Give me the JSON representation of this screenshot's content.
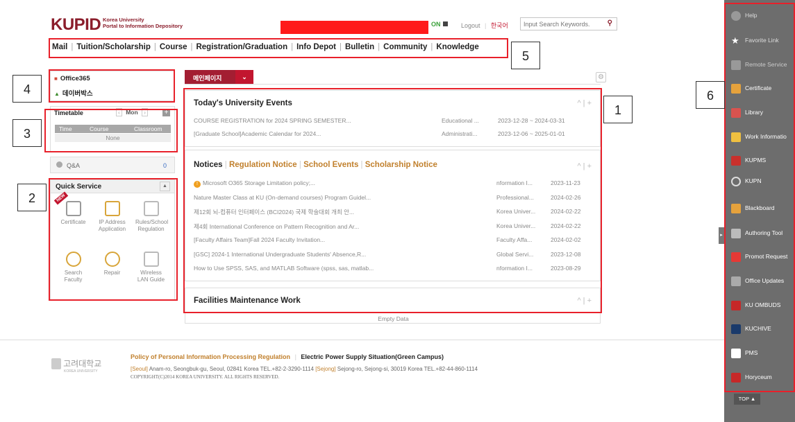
{
  "header": {
    "logo_word": "KUPID",
    "logo_sub_line1": "Korea University",
    "logo_sub_line2": "Portal to Information Depository",
    "status_on": "ON",
    "logout": "Logout",
    "language": "한국어",
    "search_placeholder": "Input Search Keywords."
  },
  "nav": [
    "Mail",
    "Tuition/Scholarship",
    "Course",
    "Registration/Graduation",
    "Info Depot",
    "Bulletin",
    "Community",
    "Knowledge"
  ],
  "annotations": [
    "1",
    "2",
    "3",
    "4",
    "5",
    "6"
  ],
  "links_box": {
    "office365": "Office365",
    "korean_item": "데이버박스"
  },
  "timetable": {
    "title": "Timetable",
    "day": "Mon",
    "columns": [
      "Time",
      "Course",
      "Classroom"
    ],
    "empty": "None"
  },
  "qa": {
    "label": "Q&A",
    "count": "0"
  },
  "quick_service": {
    "title": "Quick Service",
    "items": [
      {
        "label": "Certificate",
        "icon": "certificate-icon"
      },
      {
        "label": "IP Address Application",
        "icon": "monitor-icon"
      },
      {
        "label": "Rules/School Regulation",
        "icon": "document-icon"
      },
      {
        "label": "Search Faculty",
        "icon": "person-search-icon"
      },
      {
        "label": "Repair",
        "icon": "gear-icon"
      },
      {
        "label": "Wireless LAN Guide",
        "icon": "phone-icon"
      }
    ],
    "badge": "NEW"
  },
  "main": {
    "tab_label": "메인페이지",
    "events": {
      "title": "Today's University Events",
      "rows": [
        {
          "title": "COURSE REGISTRATION for 2024 SPRING SEMESTER...",
          "category": "Educational ...",
          "date": "2023-12-28 ~ 2024-03-31"
        },
        {
          "title": "[Graduate School]Academic Calendar for 2024...",
          "category": "Administrati...",
          "date": "2023-12-06 ~ 2025-01-01"
        }
      ]
    },
    "notices": {
      "tabs": [
        "Notices",
        "Regulation Notice",
        "School Events",
        "Scholarship Notice"
      ],
      "rows": [
        {
          "title": "Microsoft O365 Storage Limitation policy;...",
          "category": "nformation I...",
          "date": "2023-11-23"
        },
        {
          "title": "Nature Master Class at KU (On-demand courses) Program Guidel...",
          "category": "Professional...",
          "date": "2024-02-26"
        },
        {
          "title": "제12회 뇌-컴퓨터 인터페이스 (BCI2024) 국제 학술대회 개최 안...",
          "category": "Korea Univer...",
          "date": "2024-02-22"
        },
        {
          "title": "제4회 International Conference on Pattern Recognition and Ar...",
          "category": "Korea Univer...",
          "date": "2024-02-22"
        },
        {
          "title": "[Faculty Affairs Team]Fall 2024 Faculty Invitation...",
          "category": "Faculty Affa...",
          "date": "2024-02-02"
        },
        {
          "title": "[GSC] 2024-1 International Undergraduate Students' Absence,R...",
          "category": "Global Servi...",
          "date": "2023-12-08"
        },
        {
          "title": "How to Use SPSS, SAS, and MATLAB Software (spss, sas, matlab...",
          "category": "nformation I...",
          "date": "2023-08-29"
        }
      ]
    },
    "facilities": {
      "title": "Facilities Maintenance Work",
      "empty": "Empty Data"
    }
  },
  "footer": {
    "uni_name": "고려대학교",
    "uni_sub": "KOREA UNIVERSITY",
    "policy": "Policy of Personal Information Processing Regulation",
    "power": "Electric Power Supply Situation(Green Campus)",
    "address_seoul_tag": "[Seoul]",
    "address_seoul": "Anam-ro, Seongbuk-gu, Seoul, 02841 Korea TEL.+82-2-3290-1114",
    "address_sejong_tag": "[Sejong]",
    "address_sejong": "Sejong-ro, Sejong-si, 30019 Korea TEL.+82-44-860-1114",
    "copyright": "COPYRIGHT(C)2014 KOREA UNIVERSITY. ALL RIGHTS RESERVED."
  },
  "sidebar": {
    "items": [
      {
        "label": "Help",
        "icon": "help-icon"
      },
      {
        "label": "Favorite Link",
        "icon": "star-icon"
      },
      {
        "label": "Remote Service",
        "icon": "remote-icon"
      },
      {
        "label": "Certificate",
        "icon": "certificate-icon"
      },
      {
        "label": "Library",
        "icon": "library-icon"
      },
      {
        "label": "Work Informatio",
        "icon": "work-icon"
      },
      {
        "label": "KUPMS",
        "icon": "kupms-icon"
      },
      {
        "label": "KUPN",
        "icon": "network-icon"
      },
      {
        "label": "Blackboard",
        "icon": "blackboard-icon"
      },
      {
        "label": "Authoring Tool",
        "icon": "authoring-icon"
      },
      {
        "label": "Promot Request",
        "icon": "megaphone-icon"
      },
      {
        "label": "Office Updates",
        "icon": "office-icon"
      },
      {
        "label": "KU OMBUDS",
        "icon": "ombuds-icon"
      },
      {
        "label": "KUCHIVE",
        "icon": "kuchive-icon"
      },
      {
        "label": "PMS",
        "icon": "pms-icon"
      },
      {
        "label": "Horyceum",
        "icon": "horyceum-icon"
      }
    ],
    "top_button": "TOP ▲"
  },
  "colors": {
    "brand": "#8b1d2b",
    "annotation": "#e8202a",
    "sidebar_bg": "#6d6d6d"
  }
}
